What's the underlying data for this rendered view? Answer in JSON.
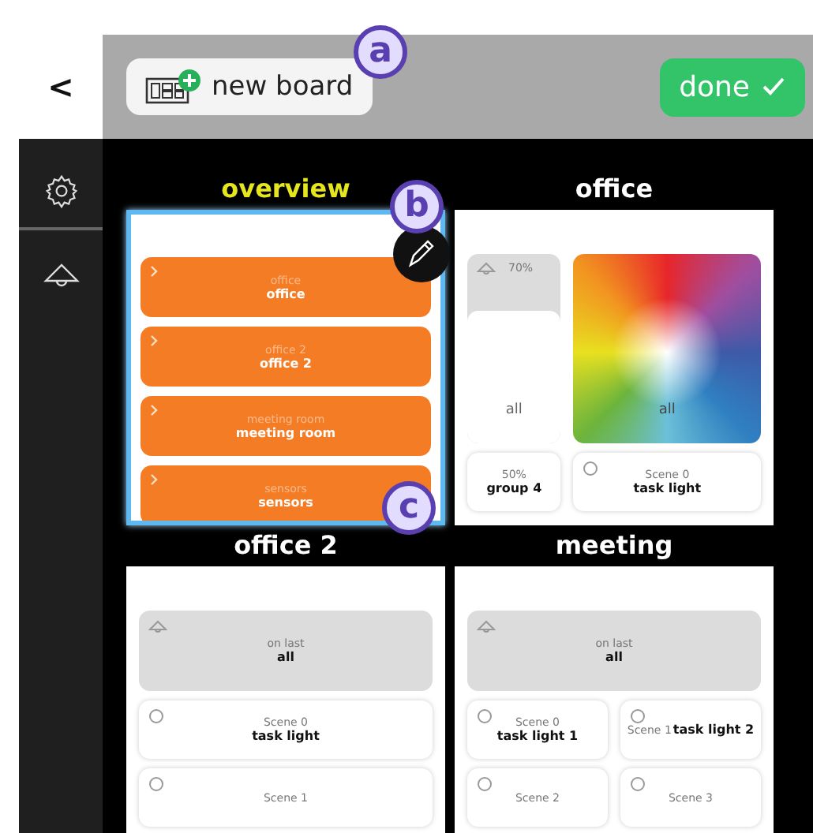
{
  "header": {
    "back": "<",
    "new_board": "new board",
    "done": "done"
  },
  "boards": [
    {
      "title": "overview",
      "selected": true,
      "rows": [
        [
          {
            "kind": "link",
            "caption": "office",
            "name": "office"
          }
        ],
        [
          {
            "kind": "link",
            "caption": "office 2",
            "name": "office 2"
          }
        ],
        [
          {
            "kind": "link",
            "caption": "meeting room",
            "name": "meeting room"
          }
        ],
        [
          {
            "kind": "link",
            "caption": "sensors",
            "name": "sensors"
          }
        ]
      ]
    },
    {
      "title": "office",
      "selected": false,
      "rows": [
        [
          {
            "kind": "slider",
            "level": 0.7,
            "reading": "70%",
            "name": "all"
          },
          {
            "kind": "color",
            "name": "all"
          }
        ],
        [
          {
            "kind": "value",
            "caption": "50%",
            "name": "group 4"
          },
          {
            "kind": "scene",
            "caption": "Scene 0",
            "name": "task light"
          }
        ]
      ]
    },
    {
      "title": "office 2",
      "selected": false,
      "rows": [
        [
          {
            "kind": "group",
            "caption": "on last",
            "name": "all"
          }
        ],
        [
          {
            "kind": "scene",
            "caption": "Scene 0",
            "name": "task light"
          }
        ],
        [
          {
            "kind": "scene",
            "caption": "Scene 1"
          }
        ]
      ]
    },
    {
      "title": "meeting",
      "selected": false,
      "rows": [
        [
          {
            "kind": "group",
            "caption": "on last",
            "name": "all"
          }
        ],
        [
          {
            "kind": "scene",
            "caption": "Scene 0",
            "name": "task light 1"
          },
          {
            "kind": "scene_inline",
            "caption": "Scene 1",
            "name": "task light 2"
          }
        ],
        [
          {
            "kind": "scene",
            "caption": "Scene 2"
          },
          {
            "kind": "scene",
            "caption": "Scene 3"
          }
        ]
      ]
    }
  ],
  "callouts": [
    {
      "label": "a"
    },
    {
      "label": "b"
    },
    {
      "label": "c"
    }
  ]
}
